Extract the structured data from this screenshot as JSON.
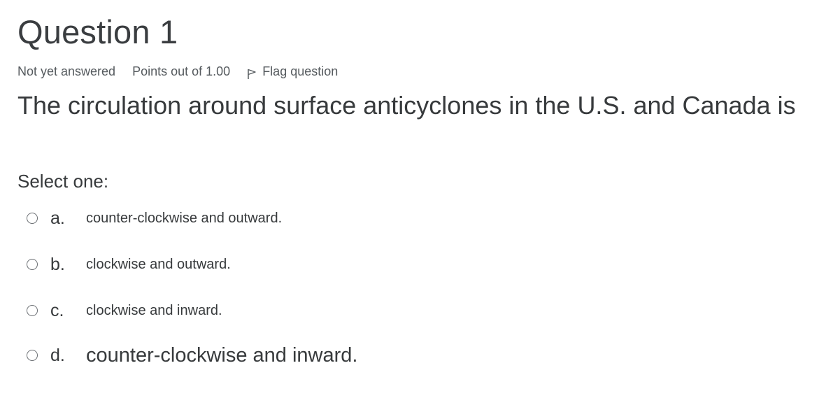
{
  "question": {
    "title": "Question 1",
    "state": "Not yet answered",
    "grade": "Points out of 1.00",
    "flag_label": "Flag question",
    "text": "The circulation around surface anticyclones in the U.S. and Canada is",
    "prompt": "Select one:",
    "answers": [
      {
        "letter": "a.",
        "text": "counter-clockwise and outward."
      },
      {
        "letter": "b.",
        "text": "clockwise and outward."
      },
      {
        "letter": "c.",
        "text": "clockwise and inward."
      },
      {
        "letter": "d.",
        "text": "counter-clockwise and inward."
      }
    ]
  },
  "icons": {
    "flag": "flag-icon"
  }
}
